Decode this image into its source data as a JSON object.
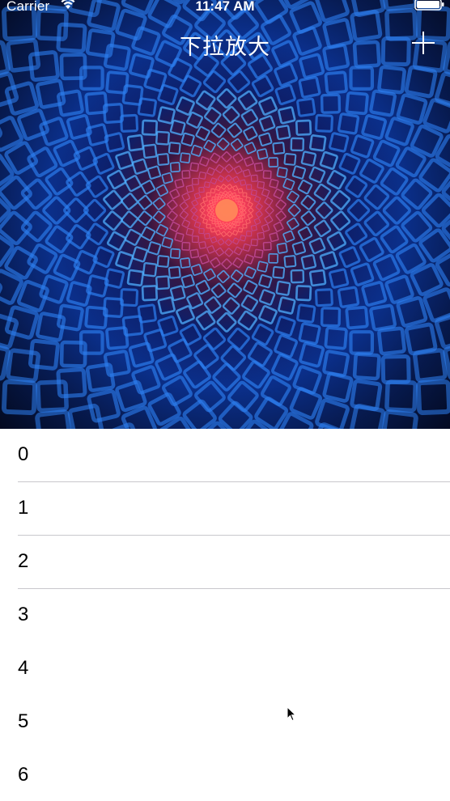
{
  "status_bar": {
    "carrier": "Carrier",
    "time": "11:47 AM",
    "wifi_icon": "wifi-icon",
    "battery_icon": "battery-icon"
  },
  "nav_bar": {
    "title": "下拉放大",
    "right_button_icon": "plus-icon"
  },
  "header_image": {
    "description_icon": "tunnel-image",
    "colors": {
      "center": "#ff4a4a",
      "inner": "#c0304a",
      "outer": "#0b3f9f",
      "edge": "#000000"
    }
  },
  "table": {
    "rows": [
      {
        "label": "0",
        "separator": true
      },
      {
        "label": "1",
        "separator": true
      },
      {
        "label": "2",
        "separator": true
      },
      {
        "label": "3",
        "separator": false
      },
      {
        "label": "4",
        "separator": false
      },
      {
        "label": "5",
        "separator": false
      },
      {
        "label": "6",
        "separator": false
      }
    ]
  },
  "colors": {
    "separator": "#c8c7cc",
    "background": "#ffffff",
    "nav_text": "#ffffff"
  }
}
